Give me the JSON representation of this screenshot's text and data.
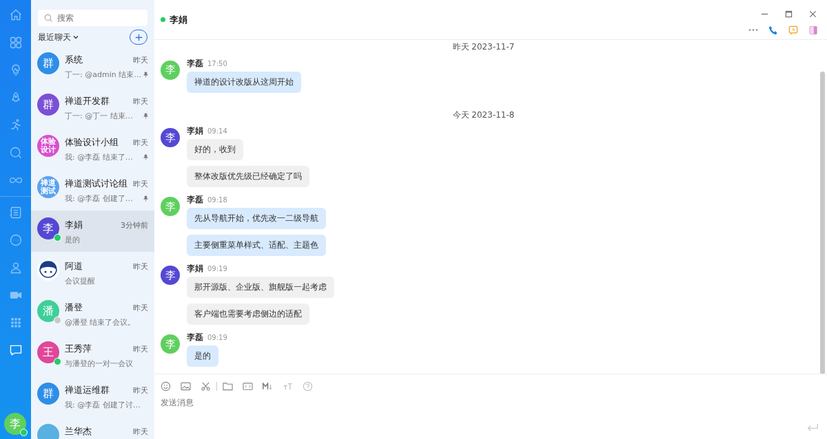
{
  "rail": {
    "items": [
      {
        "selected": false
      },
      {
        "selected": false
      },
      {
        "selected": false
      },
      {
        "selected": false
      },
      {
        "selected": false
      },
      {
        "selected": false
      },
      {
        "selected": false
      },
      {
        "selected": false
      },
      {
        "selected": false
      },
      {
        "selected": false
      },
      {
        "selected": false
      },
      {
        "selected": false
      },
      {
        "selected": true
      }
    ],
    "user": {
      "avatar": "李",
      "online": true
    }
  },
  "list": {
    "search": {
      "placeholder": "搜索"
    },
    "filter": "最近聊天",
    "conversations": [
      {
        "kind": "initial",
        "avatar": "群",
        "color": "#2e8ee8",
        "name": "系统",
        "time": "昨天",
        "preview": "丁一: @admin 结束…",
        "pinned": true,
        "selected": false
      },
      {
        "kind": "initial",
        "avatar": "群",
        "color": "#7b4fd6",
        "name": "禅道开发群",
        "time": "昨天",
        "preview": "丁一: @丁一 结束…",
        "pinned": true,
        "selected": false
      },
      {
        "kind": "compact",
        "avatar": "体验设计",
        "color": "#d94fd0",
        "name": "体验设计小组",
        "time": "昨天",
        "preview": "我: @李磊 结束了…",
        "pinned": true,
        "selected": false
      },
      {
        "kind": "compact",
        "avatar": "禅道测试",
        "color": "#5aa2ee",
        "name": "禅道测试讨论组",
        "time": "昨天",
        "preview": "我: @李磊 创建了…",
        "pinned": true,
        "selected": false
      },
      {
        "kind": "initial",
        "avatar": "李",
        "color": "#5448d4",
        "name": "李娟",
        "time": "3分钟前",
        "preview": "是的",
        "pinned": false,
        "online": true,
        "selected": true
      },
      {
        "kind": "mascot",
        "name": "阿道",
        "time": "昨天",
        "preview": "会议提醒",
        "pinned": false,
        "selected": false
      },
      {
        "kind": "initial",
        "avatar": "潘",
        "color": "#3fcf9a",
        "name": "潘登",
        "time": "昨天",
        "preview": "@潘登 结束了会议。",
        "pinned": false,
        "online": false,
        "selected": false
      },
      {
        "kind": "initial",
        "avatar": "王",
        "color": "#e0479a",
        "name": "王秀萍",
        "time": "昨天",
        "preview": "与潘登的一对一会议",
        "pinned": false,
        "online": true,
        "selected": false
      },
      {
        "kind": "initial",
        "avatar": "群",
        "color": "#2e8ee8",
        "name": "禅道运维群",
        "time": "昨天",
        "preview": "我: @李磊 创建了讨…",
        "pinned": false,
        "selected": false
      },
      {
        "kind": "initial",
        "color": "#5ab0e0",
        "name": "兰华杰",
        "time": "昨天",
        "pinned": false,
        "selected": false
      }
    ]
  },
  "chat": {
    "title": "李娟",
    "online": true,
    "items": [
      {
        "kind": "date",
        "text": "昨天 2023-11-7"
      },
      {
        "kind": "group",
        "sender": "李磊",
        "avatar": "李",
        "color": "#5fcf5f",
        "time": "17:50",
        "mine": true,
        "messages": [
          "禅道的设计改版从这周开始"
        ]
      },
      {
        "kind": "date",
        "text": "今天 2023-11-8"
      },
      {
        "kind": "group",
        "sender": "李娟",
        "avatar": "李",
        "color": "#5448d4",
        "time": "09:14",
        "mine": false,
        "messages": [
          "好的，收到",
          "整体改版优先级已经确定了吗"
        ]
      },
      {
        "kind": "group",
        "sender": "李磊",
        "avatar": "李",
        "color": "#5fcf5f",
        "time": "09:18",
        "mine": true,
        "messages": [
          "先从导航开始，优先改一二级导航",
          "主要侧重菜单样式、适配、主题色"
        ]
      },
      {
        "kind": "group",
        "sender": "李娟",
        "avatar": "李",
        "color": "#5448d4",
        "time": "09:19",
        "mine": false,
        "messages": [
          "那开源版、企业版、旗舰版一起考虑",
          "客户端也需要考虑侧边的适配"
        ]
      },
      {
        "kind": "group",
        "sender": "李磊",
        "avatar": "李",
        "color": "#5fcf5f",
        "time": "09:19",
        "mine": true,
        "messages": [
          "是的"
        ]
      }
    ],
    "composer": {
      "placeholder": "发送消息"
    }
  }
}
